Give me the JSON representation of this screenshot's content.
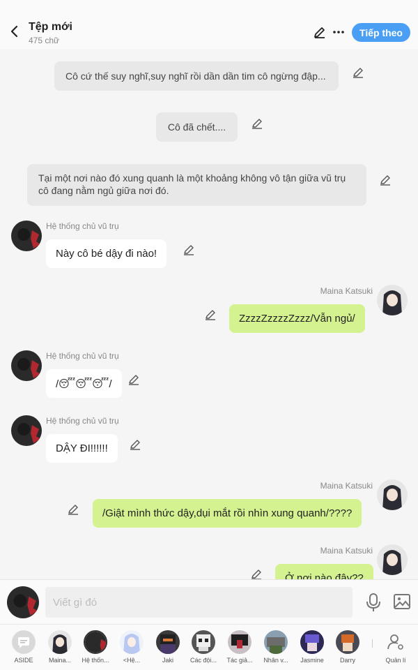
{
  "header": {
    "title": "Tệp mới",
    "word_count": "475 chữ",
    "follow_label": "Tiếp theo"
  },
  "messages": {
    "narr1": "Cô cứ thế suy nghĩ,suy nghĩ rồi dần dần tim cô ngừng đập...",
    "narr2": "Cô đã chết....",
    "narr3_line1": "Tại một nơi nào đó xung quanh là một khoảng không vô tận giữa vũ trụ",
    "narr3_line2": "cô đang nằm ngủ giữa nơi đó.",
    "m1_sender": "Hệ thống chủ vũ trụ",
    "m1_text": "Này cô bé dậy đi nào!",
    "m2_sender": "Maina Katsuki",
    "m2_text": "ZzzzZzzzzZzzz/Vẫn ngủ/",
    "m3_sender": "Hệ thống chủ vũ trụ",
    "m3_text": "/😴😴😴/",
    "m4_sender": "Hệ thống chủ vũ trụ",
    "m4_text": "DẬY ĐI!!!!!!",
    "m5_sender": "Maina Katsuki",
    "m5_text": "/Giật mình thức dậy,dụi mắt rồi nhìn xung quanh/????",
    "m6_sender": "Maina Katsuki",
    "m6_text": "Ở nơi nào đây??"
  },
  "composer": {
    "placeholder": "Viết gì đó"
  },
  "characters": [
    {
      "label": "ASIDE",
      "icon": "aside-icon"
    },
    {
      "label": "Maina...",
      "icon": "maina-avatar"
    },
    {
      "label": "Hệ thốn...",
      "icon": "system-avatar"
    },
    {
      "label": "<Hệ...",
      "icon": "blue-hair-avatar"
    },
    {
      "label": "Jaki",
      "icon": "jaki-avatar"
    },
    {
      "label": "Các đội...",
      "icon": "skull-avatar"
    },
    {
      "label": "Tác giả...",
      "icon": "author-avatar"
    },
    {
      "label": "Nhân v...",
      "icon": "character-avatar"
    },
    {
      "label": "Jasmine",
      "icon": "jasmine-avatar"
    },
    {
      "label": "Darry",
      "icon": "darry-avatar"
    }
  ],
  "manage_label": "Quản lí",
  "colors": {
    "accent": "#4a9ff5",
    "user_bubble": "#d4f28f",
    "narration_bg": "#e8e8e8"
  }
}
